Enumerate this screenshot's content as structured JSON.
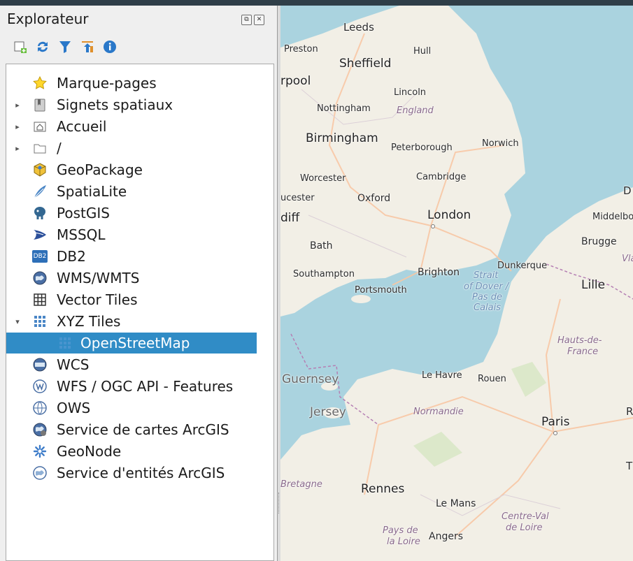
{
  "panel": {
    "title": "Explorateur",
    "dock_float_label": "⧉",
    "dock_close_label": "✕"
  },
  "toolbar": {
    "add_layer": "add-layer-icon",
    "refresh": "refresh-icon",
    "filter": "filter-icon",
    "collapse": "collapse-all-icon",
    "properties": "info-icon"
  },
  "tree": {
    "items": [
      {
        "label": "Marque-pages",
        "icon": "star-icon",
        "expander": ""
      },
      {
        "label": "Signets spatiaux",
        "icon": "bookmark-icon",
        "expander": "▸"
      },
      {
        "label": "Accueil",
        "icon": "home-folder-icon",
        "expander": "▸"
      },
      {
        "label": "/",
        "icon": "folder-icon",
        "expander": "▸"
      },
      {
        "label": "GeoPackage",
        "icon": "geopackage-icon",
        "expander": ""
      },
      {
        "label": "SpatiaLite",
        "icon": "spatialite-icon",
        "expander": ""
      },
      {
        "label": "PostGIS",
        "icon": "postgis-icon",
        "expander": ""
      },
      {
        "label": "MSSQL",
        "icon": "mssql-icon",
        "expander": ""
      },
      {
        "label": "DB2",
        "icon": "db2-icon",
        "expander": ""
      },
      {
        "label": "WMS/WMTS",
        "icon": "wms-icon",
        "expander": ""
      },
      {
        "label": "Vector Tiles",
        "icon": "vector-tiles-icon",
        "expander": ""
      },
      {
        "label": "XYZ Tiles",
        "icon": "xyz-tiles-icon",
        "expander": "▾"
      },
      {
        "label": "OpenStreetMap",
        "icon": "xyz-tile-layer-icon",
        "expander": ""
      },
      {
        "label": "WCS",
        "icon": "wcs-icon",
        "expander": ""
      },
      {
        "label": "WFS / OGC API - Features",
        "icon": "wfs-icon",
        "expander": ""
      },
      {
        "label": "OWS",
        "icon": "ows-icon",
        "expander": ""
      },
      {
        "label": "Service de cartes ArcGIS",
        "icon": "arcgis-map-icon",
        "expander": ""
      },
      {
        "label": "GeoNode",
        "icon": "geonode-icon",
        "expander": ""
      },
      {
        "label": "Service d'entités ArcGIS",
        "icon": "arcgis-feature-icon",
        "expander": ""
      }
    ],
    "db2_badge": "DB2",
    "selected_index": 12
  },
  "map": {
    "labels": {
      "leeds": "Leeds",
      "preston": "Preston",
      "hull": "Hull",
      "sheffield": "Sheffield",
      "rpool": "rpool",
      "lincoln": "Lincoln",
      "nottingham": "Nottingham",
      "england": "England",
      "birmingham": "Birmingham",
      "peterborough": "Peterborough",
      "norwich": "Norwich",
      "worcester": "Worcester",
      "cambridge": "Cambridge",
      "ucester": "ucester",
      "oxford": "Oxford",
      "d": "D",
      "diff": "diff",
      "london": "London",
      "middelb": "Middelbo",
      "bath": "Bath",
      "brugge": "Brugge",
      "dunkerque": "Dunkerque",
      "vla": "Vla",
      "southampton": "Southampton",
      "brighton": "Brighton",
      "strait": "Strait",
      "ofdover": "of Dover /",
      "pasde": "Pas de",
      "calais": "Calais",
      "portsmouth": "Portsmouth",
      "lille": "Lille",
      "hauts": "Hauts-de-",
      "france": "France",
      "guernsey": "Guernsey",
      "lehavre": "Le Havre",
      "rouen": "Rouen",
      "jersey": "Jersey",
      "normandie": "Normandie",
      "paris": "Paris",
      "r": "R",
      "t": "T",
      "bretagne": "Bretagne",
      "rennes": "Rennes",
      "lemans": "Le Mans",
      "centreval": "Centre-Val",
      "deloire": "de Loire",
      "paysde": "Pays de",
      "laloire": "la Loire",
      "angers": "Angers"
    }
  }
}
